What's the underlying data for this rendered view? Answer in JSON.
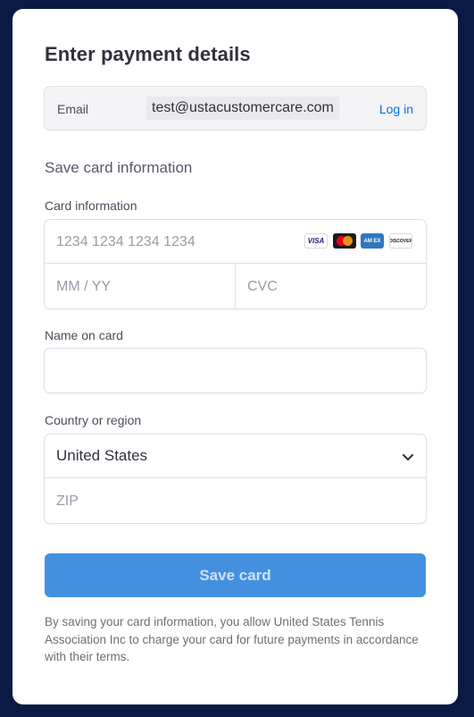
{
  "header": {
    "title": "Enter payment details"
  },
  "email": {
    "label": "Email",
    "value": "test@ustacustomercare.com",
    "login_label": "Log in"
  },
  "section_title": "Save card information",
  "card_info": {
    "label": "Card information",
    "number_placeholder": "1234 1234 1234 1234",
    "expiry_placeholder": "MM / YY",
    "cvc_placeholder": "CVC",
    "brands": {
      "visa": "VISA",
      "amex": "AM EX",
      "discover": "DISCOVER"
    }
  },
  "name_on_card": {
    "label": "Name on card",
    "value": ""
  },
  "country": {
    "label": "Country or region",
    "selected": "United States",
    "zip_placeholder": "ZIP"
  },
  "save_button": {
    "label": "Save card"
  },
  "disclaimer": "By saving your card information, you allow United States Tennis Association Inc to charge your card for future payments in accordance with their terms.",
  "colors": {
    "background": "#0a1a44",
    "accent": "#4390e0",
    "link": "#0570de"
  },
  "icons": {
    "dropdown": "chevron-down-icon"
  }
}
